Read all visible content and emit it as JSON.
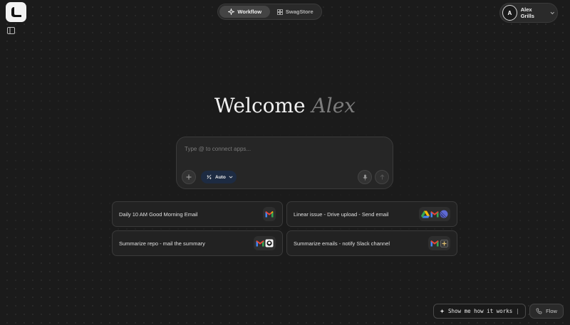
{
  "header": {
    "tabs": [
      {
        "label": "Workflow",
        "icon": "workflow-icon",
        "active": true
      },
      {
        "label": "SwagStore",
        "icon": "store-icon",
        "active": false
      }
    ],
    "user": {
      "initial": "A",
      "name": "Alex Grills"
    }
  },
  "welcome": {
    "greeting": "Welcome",
    "name": "Alex"
  },
  "prompt": {
    "placeholder": "Type @ to connect apps...",
    "mode_label": "Auto"
  },
  "suggestions": [
    {
      "label": "Daily 10 AM Good Morning Email",
      "apps": [
        "gmail-icon"
      ]
    },
    {
      "label": "Linear issue - Drive upload - Send email",
      "apps": [
        "google-drive-icon",
        "gmail-icon",
        "linear-icon"
      ]
    },
    {
      "label": "Summarize repo - mail the summary",
      "apps": [
        "gmail-icon",
        "github-icon"
      ]
    },
    {
      "label": "Summarize emails - notify Slack channel",
      "apps": [
        "gmail-icon",
        "slack-icon"
      ]
    }
  ],
  "footer": {
    "show_me_label": "Show me how it works",
    "flow_label": "Flow"
  },
  "colors": {
    "background": "#1b1b1b",
    "accent_pill": "#1d2b42",
    "welcome_name": "#7c7c7c"
  }
}
